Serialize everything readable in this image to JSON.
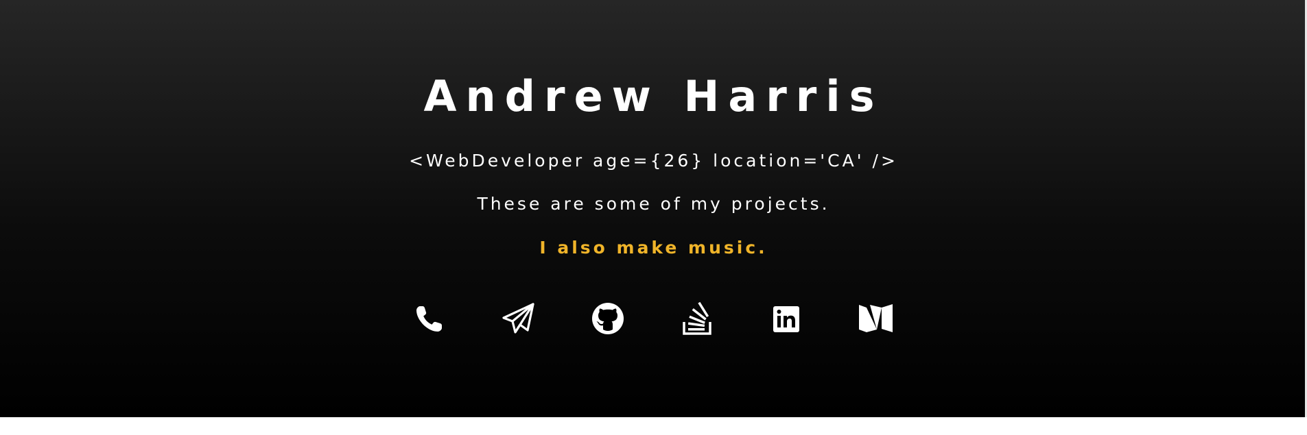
{
  "header": {
    "name": "Andrew Harris",
    "tagline": "<WebDeveloper age={26} location='CA' />",
    "projects_text": "These are some of my projects.",
    "music_link": "I also make music."
  },
  "social_links": [
    {
      "icon": "phone-icon"
    },
    {
      "icon": "paper-plane-icon"
    },
    {
      "icon": "github-icon"
    },
    {
      "icon": "stackoverflow-icon"
    },
    {
      "icon": "linkedin-icon"
    },
    {
      "icon": "medium-icon"
    }
  ],
  "colors": {
    "background_top": "#262626",
    "background_bottom": "#000000",
    "text": "#ffffff",
    "accent": "#f0b429"
  }
}
